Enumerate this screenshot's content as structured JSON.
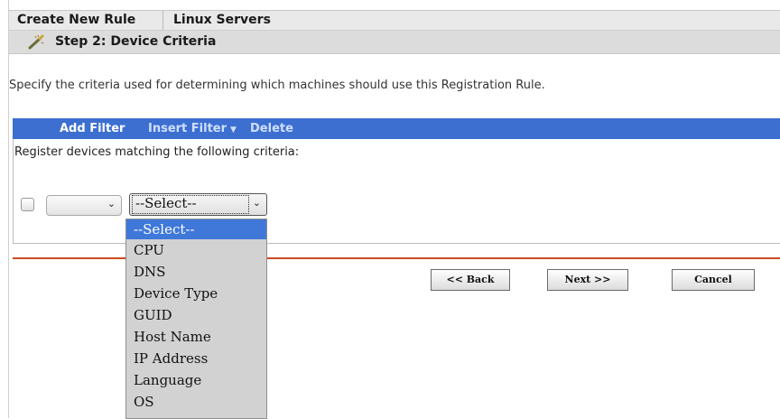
{
  "header": {
    "tab_create": "Create New Rule",
    "tab_context": "Linux Servers"
  },
  "step": {
    "title": "Step 2: Device Criteria",
    "icon": "wand-icon"
  },
  "description": "Specify the criteria used for determining which machines should use this Registration Rule.",
  "toolbar": {
    "add_filter": "Add Filter",
    "insert_filter": "Insert Filter",
    "insert_caret": "▼",
    "delete": "Delete"
  },
  "criteria_label": "Register devices matching the following criteria:",
  "filter_row": {
    "operator_value": "",
    "field_value": "--Select--",
    "chevron": "⌄"
  },
  "dropdown": {
    "options": [
      "--Select--",
      "CPU",
      "DNS",
      "Device Type",
      "GUID",
      "Host Name",
      "IP Address",
      "Language",
      "OS"
    ],
    "selected_index": 0
  },
  "buttons": {
    "back": "<< Back",
    "next": "Next >>",
    "cancel": "Cancel"
  },
  "colors": {
    "toolbar": "#3d6fd1",
    "rule": "#cf4a1e",
    "selected": "#3f78d9"
  }
}
